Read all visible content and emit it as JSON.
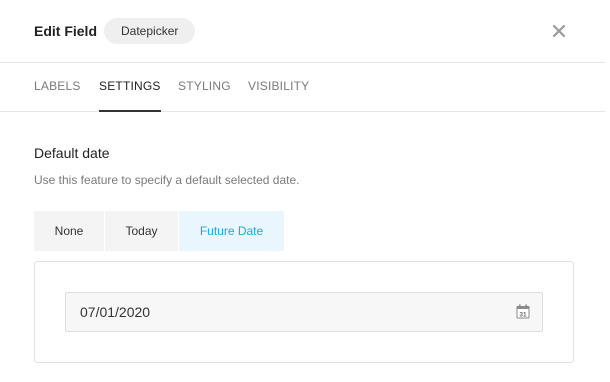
{
  "header": {
    "title": "Edit Field",
    "field_type": "Datepicker",
    "close_icon": "close-icon"
  },
  "tabs": [
    {
      "label": "LABELS",
      "active": false
    },
    {
      "label": "SETTINGS",
      "active": true
    },
    {
      "label": "STYLING",
      "active": false
    },
    {
      "label": "VISIBILITY",
      "active": false
    }
  ],
  "default_date": {
    "title": "Default date",
    "description": "Use this feature to specify a default selected date.",
    "options": [
      {
        "label": "None",
        "selected": false
      },
      {
        "label": "Today",
        "selected": false
      },
      {
        "label": "Future Date",
        "selected": true
      }
    ],
    "date_value": "07/01/2020",
    "calendar_icon": "calendar-icon",
    "calendar_day": "31"
  },
  "colors": {
    "accent": "#1ea7e0",
    "selected_bg": "#e9f6fd",
    "border": "#e6e6e6"
  }
}
